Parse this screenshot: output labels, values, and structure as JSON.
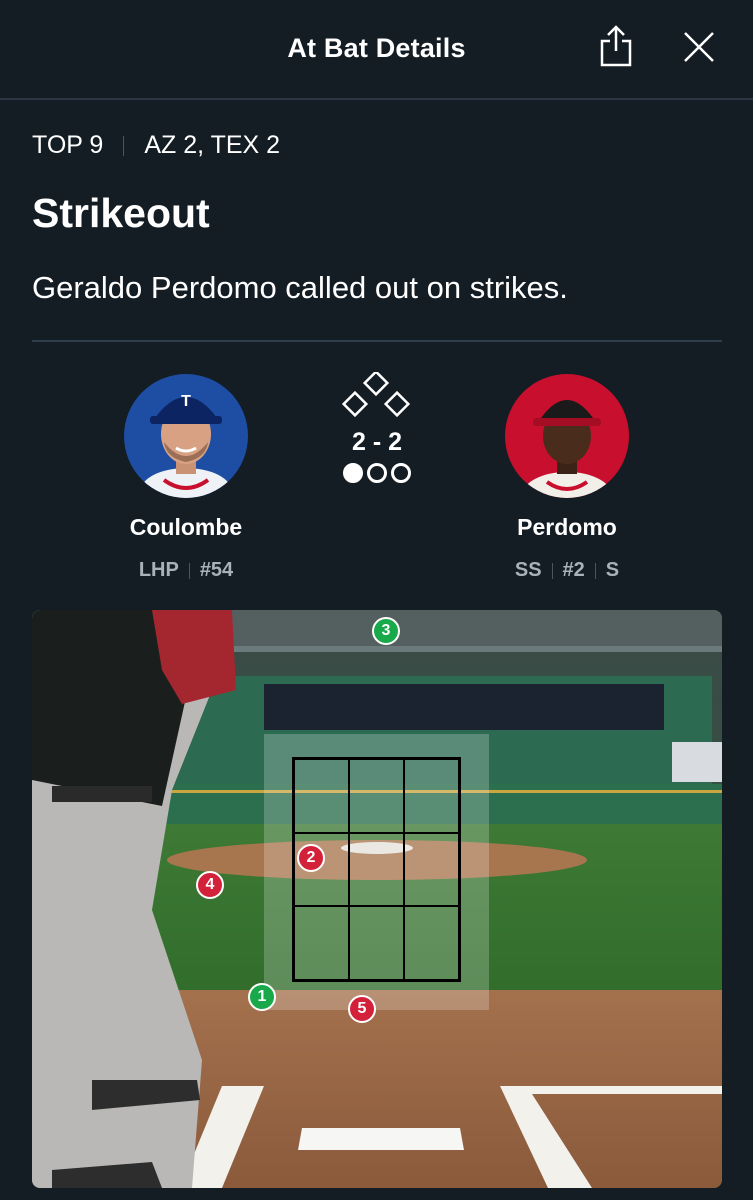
{
  "header": {
    "title": "At Bat Details",
    "share_icon": "share-icon",
    "close_icon": "close-icon"
  },
  "situation": {
    "inning": "TOP 9",
    "score": "AZ 2, TEX 2"
  },
  "play": {
    "title": "Strikeout",
    "description": "Geraldo Perdomo called out on strikes."
  },
  "pitcher": {
    "name": "Coulombe",
    "position": "LHP",
    "number": "#54",
    "team_color": "#1d4ea3"
  },
  "batter": {
    "name": "Perdomo",
    "position": "SS",
    "number": "#2",
    "bats": "S",
    "team_color": "#c8102e"
  },
  "count": {
    "display": "2 - 2",
    "outs_filled": 1,
    "outs_total": 3,
    "bases_occupied": []
  },
  "pitches": [
    {
      "number": "1",
      "result": "ball"
    },
    {
      "number": "2",
      "result": "strike"
    },
    {
      "number": "3",
      "result": "ball"
    },
    {
      "number": "4",
      "result": "strike"
    },
    {
      "number": "5",
      "result": "strike"
    }
  ],
  "colors": {
    "background": "#141c24",
    "ball": "#19a84a",
    "strike": "#d3213a"
  }
}
